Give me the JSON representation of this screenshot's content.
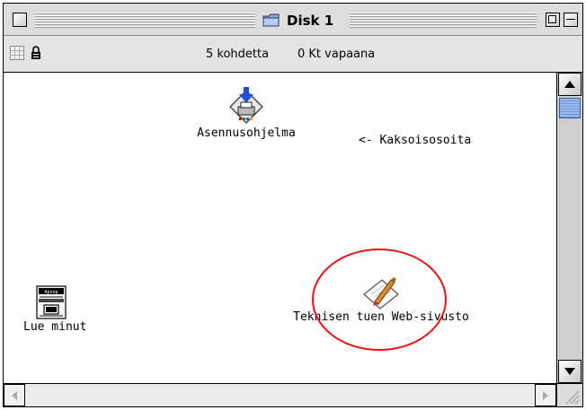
{
  "window": {
    "title": "Disk 1"
  },
  "info_bar": {
    "item_count": "5 kohdetta",
    "free_space": "0 Kt vapaana"
  },
  "desktop_items": [
    {
      "label": "Asennusohjelma",
      "icon": "installer-icon"
    },
    {
      "label": "Lue minut",
      "icon": "readme-document-icon"
    },
    {
      "label": "Teknisen tuen Web-sivusto",
      "icon": "web-link-icon"
    }
  ],
  "hint_text": "<- Kaksoisosoita",
  "colors": {
    "highlight_circle": "#e11111",
    "scroll_thumb": "#8fb0ea"
  }
}
